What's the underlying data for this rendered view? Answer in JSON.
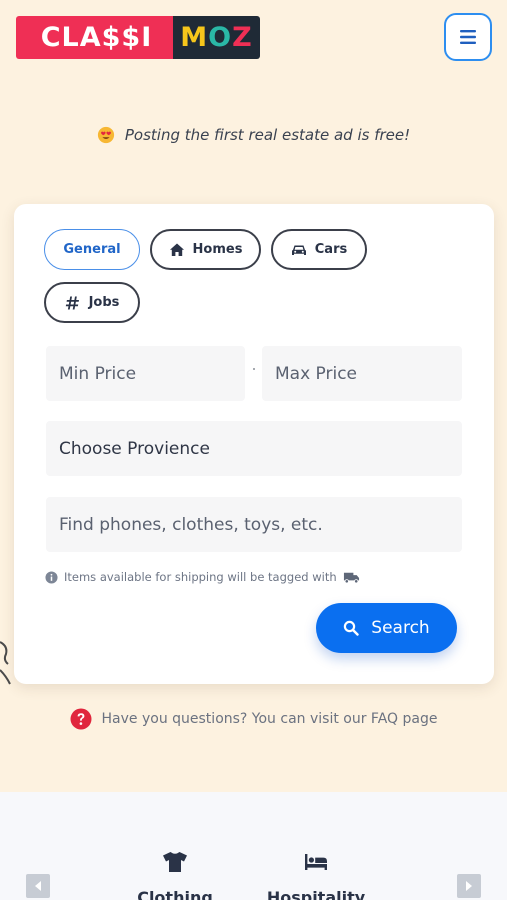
{
  "header": {
    "logo_left": "CLA$$I",
    "logo_right": [
      "M",
      "O",
      "Z"
    ],
    "menu_icon": "hamburger-icon"
  },
  "tagline": {
    "emoji": "heart-eyes-emoji",
    "text": "Posting the first real estate ad is free!"
  },
  "search": {
    "tabs": [
      {
        "label": "General",
        "icon": "",
        "active": true
      },
      {
        "label": "Homes",
        "icon": "home-icon",
        "active": false
      },
      {
        "label": "Cars",
        "icon": "car-icon",
        "active": false
      },
      {
        "label": "Jobs",
        "icon": "hashtag-icon",
        "active": false
      }
    ],
    "min_price_placeholder": "Min Price",
    "max_price_placeholder": "Max Price",
    "province_select": "Choose Provience",
    "query_placeholder": "Find phones, clothes, toys, etc.",
    "shipping_note": "Items available for shipping will be tagged with",
    "search_label": "Search"
  },
  "faq": {
    "text": "Have you questions? You can visit our FAQ page"
  },
  "categories": {
    "items": [
      {
        "label": "Clothing",
        "icon": "tshirt-icon"
      },
      {
        "label": "Hospitality",
        "icon": "bed-icon"
      }
    ]
  },
  "colors": {
    "page_bg": "#fdf2e0",
    "accent_blue": "#0a6ff0",
    "logo_red": "#ef2f55",
    "logo_dark": "#1f2a36"
  }
}
